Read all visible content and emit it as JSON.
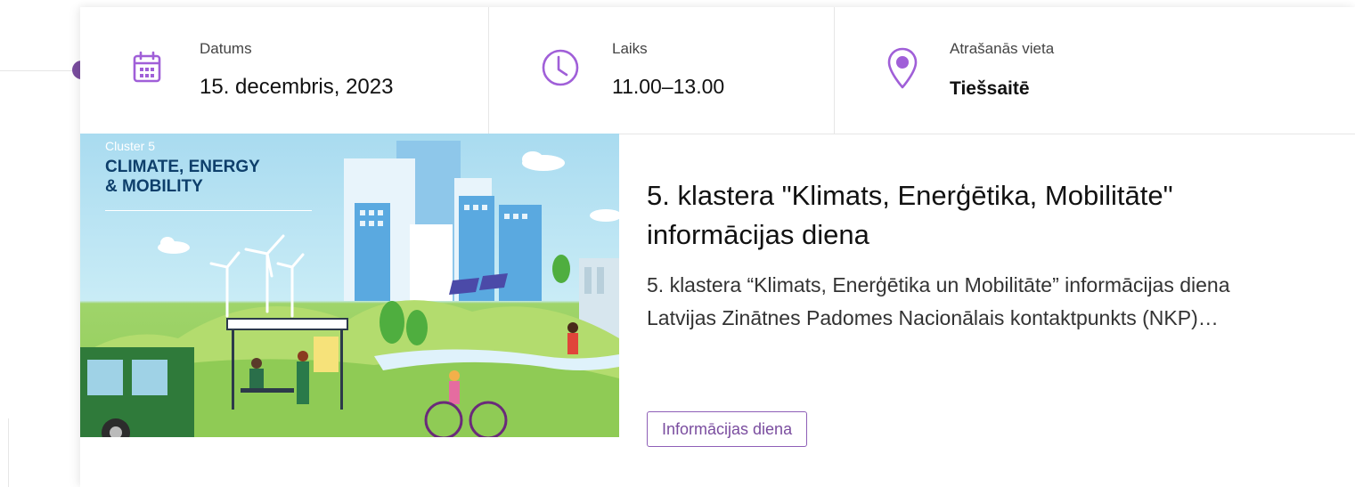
{
  "meta": {
    "date": {
      "label": "Datums",
      "value": "15. decembris, 2023",
      "icon": "calendar-icon"
    },
    "time": {
      "label": "Laiks",
      "value": "11.00–13.00",
      "icon": "clock-icon"
    },
    "location": {
      "label": "Atrašanās vieta",
      "value": "Tiešsaitē",
      "icon": "location-pin-icon"
    }
  },
  "image": {
    "cluster": "Cluster 5",
    "heading_line1": "CLIMATE, ENERGY",
    "heading_line2": "& MOBILITY"
  },
  "event": {
    "title": "5. klastera \"Klimats, Enerģētika, Mobilitāte\" informācijas diena",
    "description": " 5. klastera “Klimats, Enerģētika un Mobilitāte” informācijas diena Latvijas Zinātnes Padomes Nacionālais kontaktpunkts (NKP)…",
    "tag": "Informācijas diena"
  },
  "colors": {
    "accent": "#7a4d9f",
    "icon": "#a05fd8",
    "divider": "#e6e6e6"
  }
}
